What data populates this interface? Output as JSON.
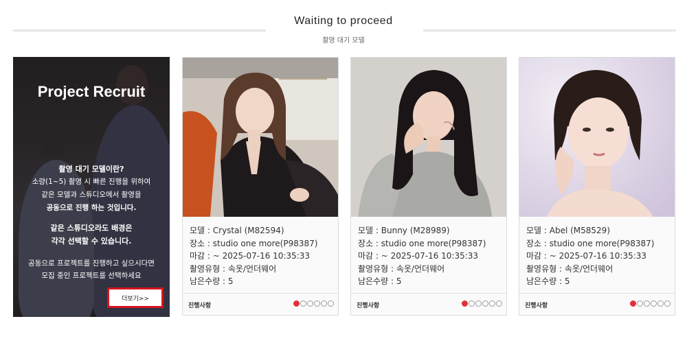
{
  "header": {
    "title": "Waiting to proceed",
    "subtitle": "촬영 대기 모델"
  },
  "recruit": {
    "title": "Project Recruit",
    "question": "촬영 대기 모델이란?",
    "line1": "소량(1~5) 촬영 시 빠른 진행을 위하여",
    "line2": "같은 모델과 스튜디오에서 촬영을",
    "line3": "공동으로 진행 하는 것입니다.",
    "bold1": "같은 스튜디오라도 배경은",
    "bold2": "각각 선택할 수 있습니다.",
    "cta1": "공동으로 프로젝트를 진행하고 싶으시다면",
    "cta2": "모집 중인 프로젝트를 선택하세요",
    "more_button": "더보기>>"
  },
  "cards": [
    {
      "model": "모델 : Crystal (M82594)",
      "place": "장소 : studio one more(P98387)",
      "deadline": "마감 : ~ 2025-07-16 10:35:33",
      "type": "촬영유형 : 속옷/언더웨어",
      "remaining": "남은수량 : 5",
      "status": "진행사항",
      "progress_dots": 6,
      "progress_filled": 1
    },
    {
      "model": "모델 : Bunny (M28989)",
      "place": "장소 : studio one more(P98387)",
      "deadline": "마감 : ~ 2025-07-16 10:35:33",
      "type": "촬영유형 : 속옷/언더웨어",
      "remaining": "남은수량 : 5",
      "status": "진행사항",
      "progress_dots": 6,
      "progress_filled": 1
    },
    {
      "model": "모델 : Abel (M58529)",
      "place": "장소 : studio one more(P98387)",
      "deadline": "마감 : ~ 2025-07-16 10:35:33",
      "type": "촬영유형 : 속옷/언더웨어",
      "remaining": "남은수량 : 5",
      "status": "진행사항",
      "progress_dots": 6,
      "progress_filled": 1
    }
  ],
  "colors": {
    "accent": "#e0313a",
    "button_border": "#d6141c"
  }
}
